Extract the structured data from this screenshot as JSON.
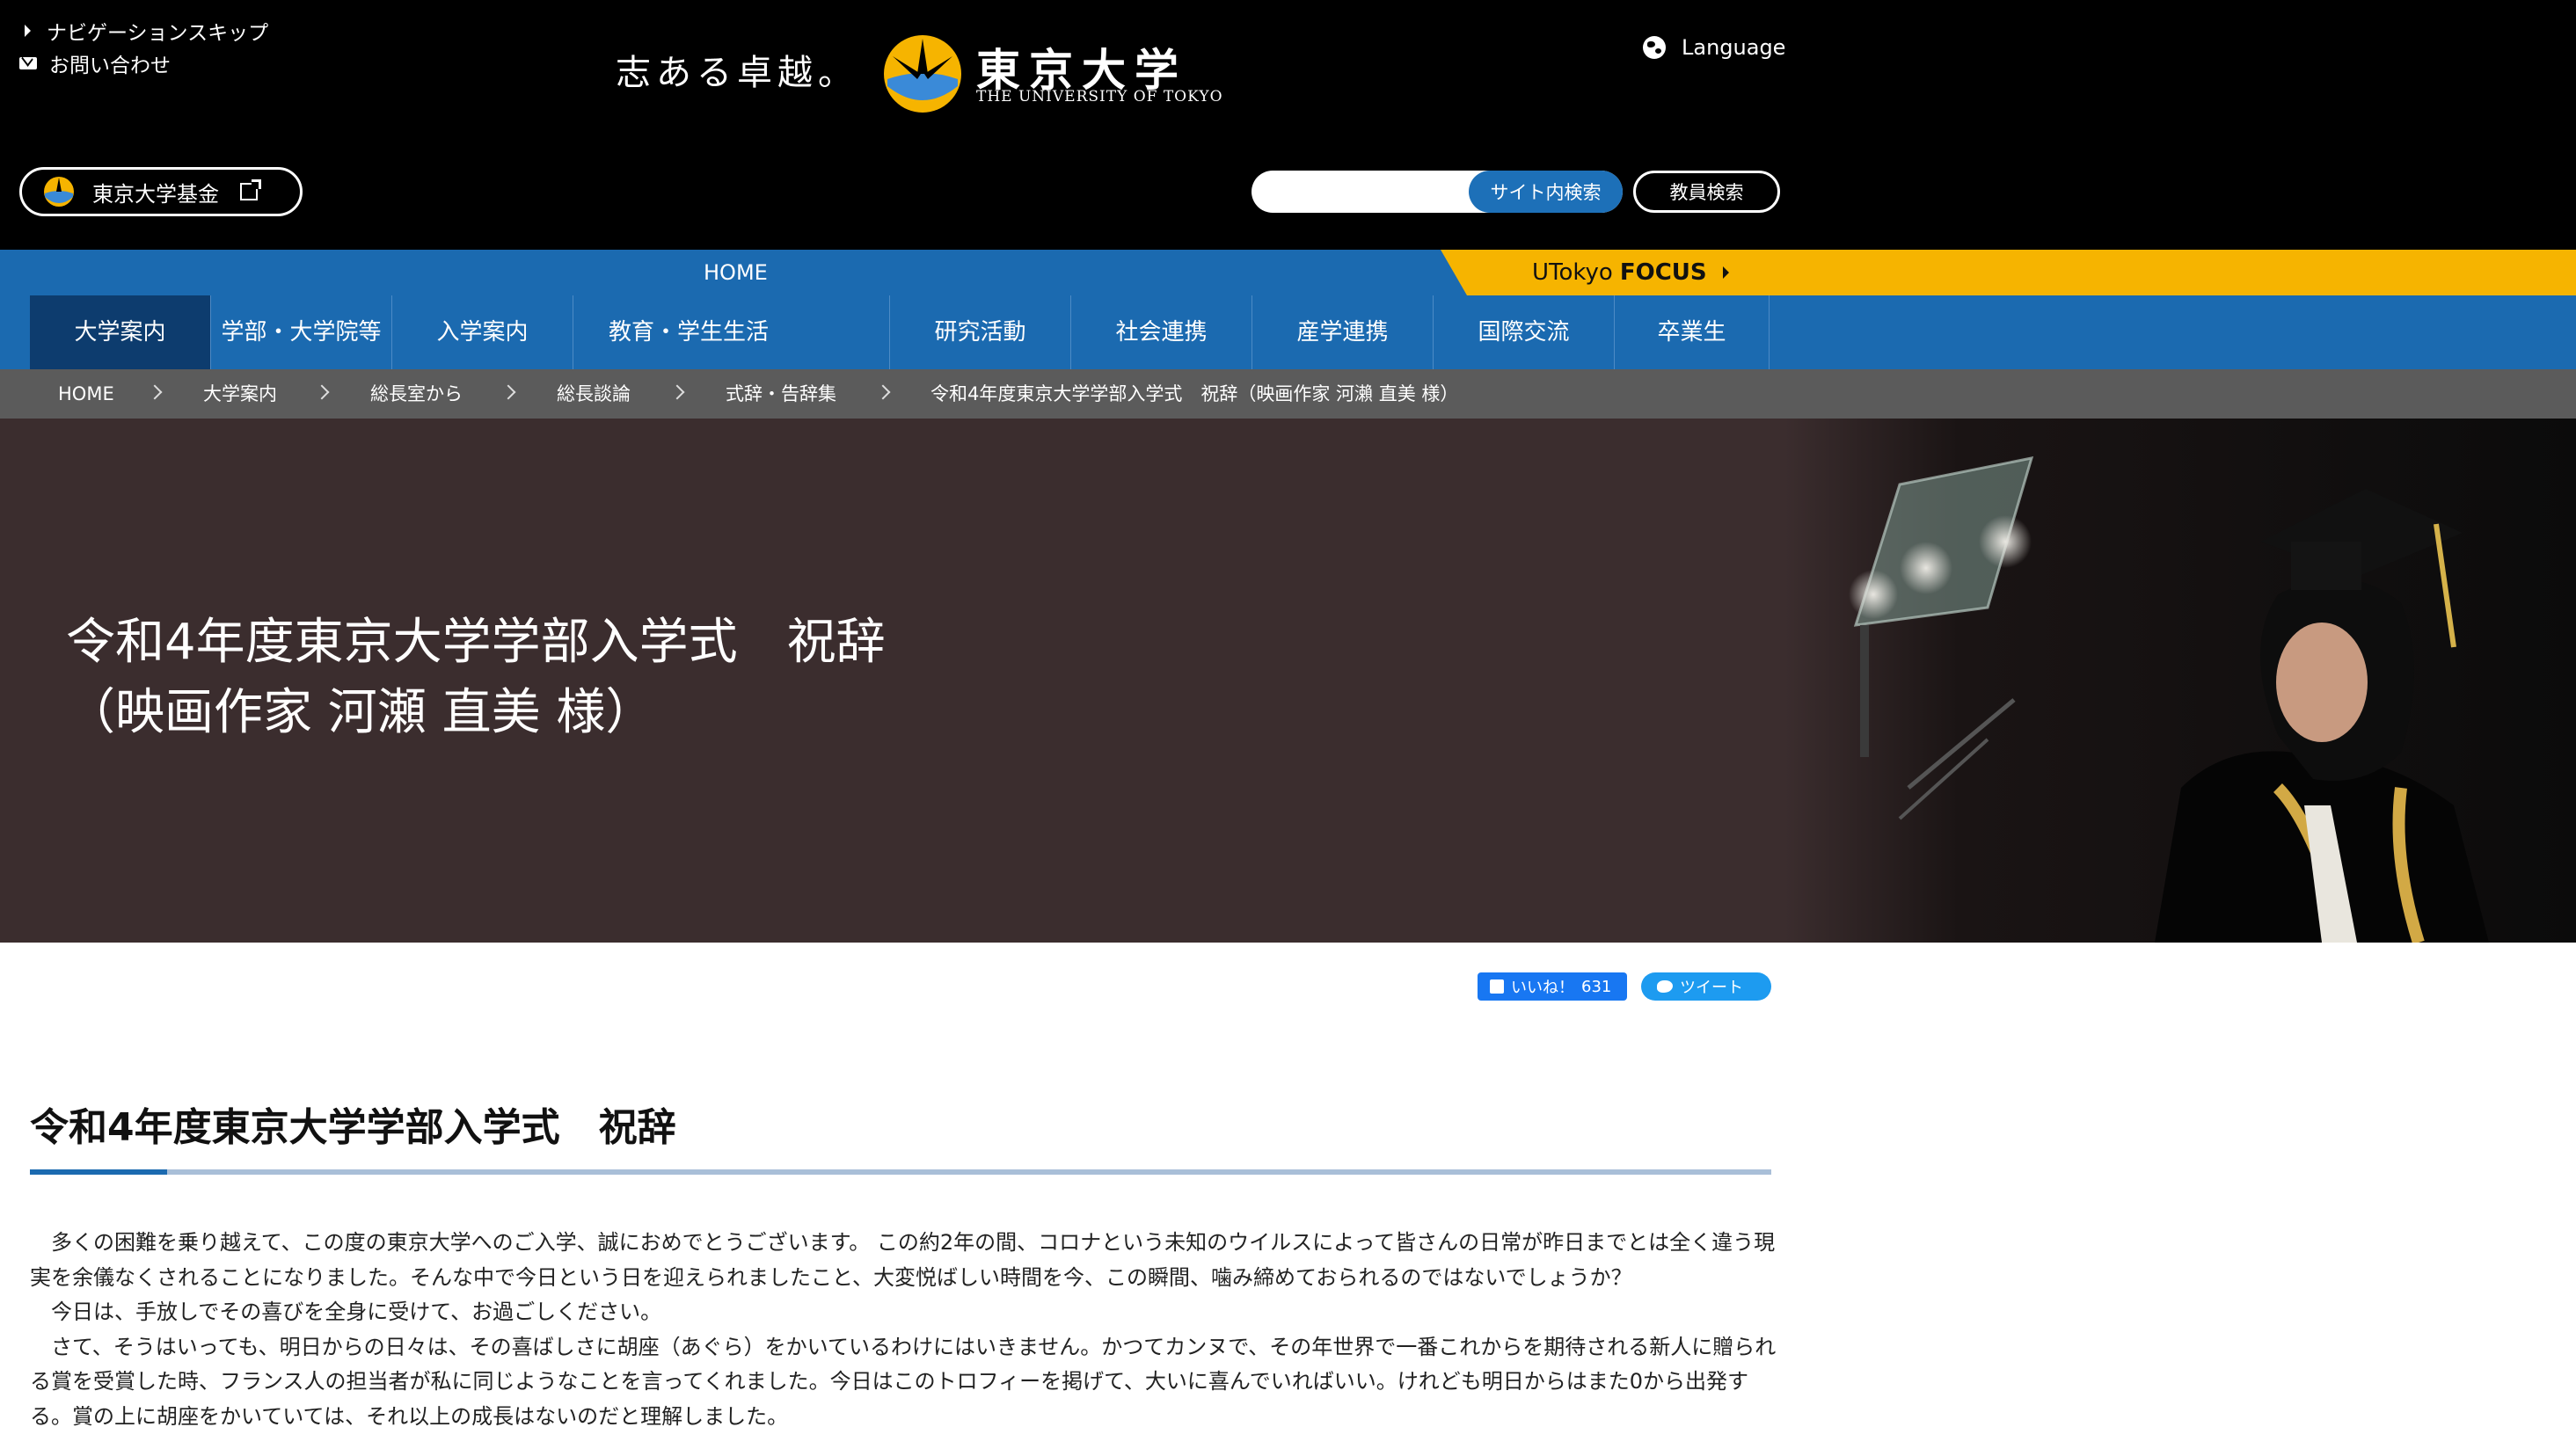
{
  "header": {
    "skip_nav": "ナビゲーションスキップ",
    "contact": "お問い合わせ",
    "tagline": "志ある卓越。",
    "logo_jp": "東京大学",
    "logo_en": "THE UNIVERSITY OF TOKYO",
    "language": "Language",
    "fund_label": "東京大学基金",
    "search_placeholder": "",
    "site_search_label": "サイト内検索",
    "staff_search_label": "教員検索"
  },
  "nav": {
    "home": "HOME",
    "focus_prefix": "UTokyo",
    "focus_bold": "FOCUS",
    "items": [
      "大学案内",
      "学部・大学院等",
      "入学案内",
      "教育・学生生活",
      "研究活動",
      "社会連携",
      "産学連携",
      "国際交流",
      "卒業生"
    ]
  },
  "breadcrumb": [
    "HOME",
    "大学案内",
    "総長室から",
    "総長談論",
    "式辞・告辞集",
    "令和4年度東京大学学部入学式　祝辞（映画作家 河瀨 直美 様）"
  ],
  "hero": {
    "title_line1": "令和4年度東京大学学部入学式　祝辞",
    "title_line2": "（映画作家 河瀬 直美 様）"
  },
  "social": {
    "like_label": "いいね！",
    "like_count": "631",
    "tweet_label": "ツイート"
  },
  "article": {
    "title": "令和4年度東京大学学部入学式　祝辞",
    "paragraphs": [
      "　多くの困難を乗り越えて、この度の東京大学へのご入学、誠におめでとうございます。 この約2年の間、コロナという未知のウイルスによって皆さんの日常が昨日までとは全く違う現実を余儀なくされることになりました。そんな中で今日という日を迎えられましたこと、大変悦ばしい時間を今、この瞬間、噛み締めておられるのではないでしょうか？",
      "　今日は、手放しでその喜びを全身に受けて、お過ごしください。",
      "　さて、そうはいっても、明日からの日々は、その喜ばしさに胡座（あぐら）をかいているわけにはいきません。かつてカンヌで、その年世界で一番これからを期待される新人に贈られる賞を受賞した時、フランス人の担当者が私に同じようなことを言ってくれました。今日はこのトロフィーを掲げて、大いに喜んでいればいい。けれども明日からはまた0から出発する。賞の上に胡座をかいていては、それ以上の成長はないのだと理解しました。"
    ]
  },
  "colors": {
    "nav_blue": "#1b6ab0",
    "nav_active": "#0d3c6e",
    "focus_yellow": "#f6b400",
    "breadcrumb_gray": "#5b5b5b",
    "hero_bg": "#3b2d2e"
  }
}
